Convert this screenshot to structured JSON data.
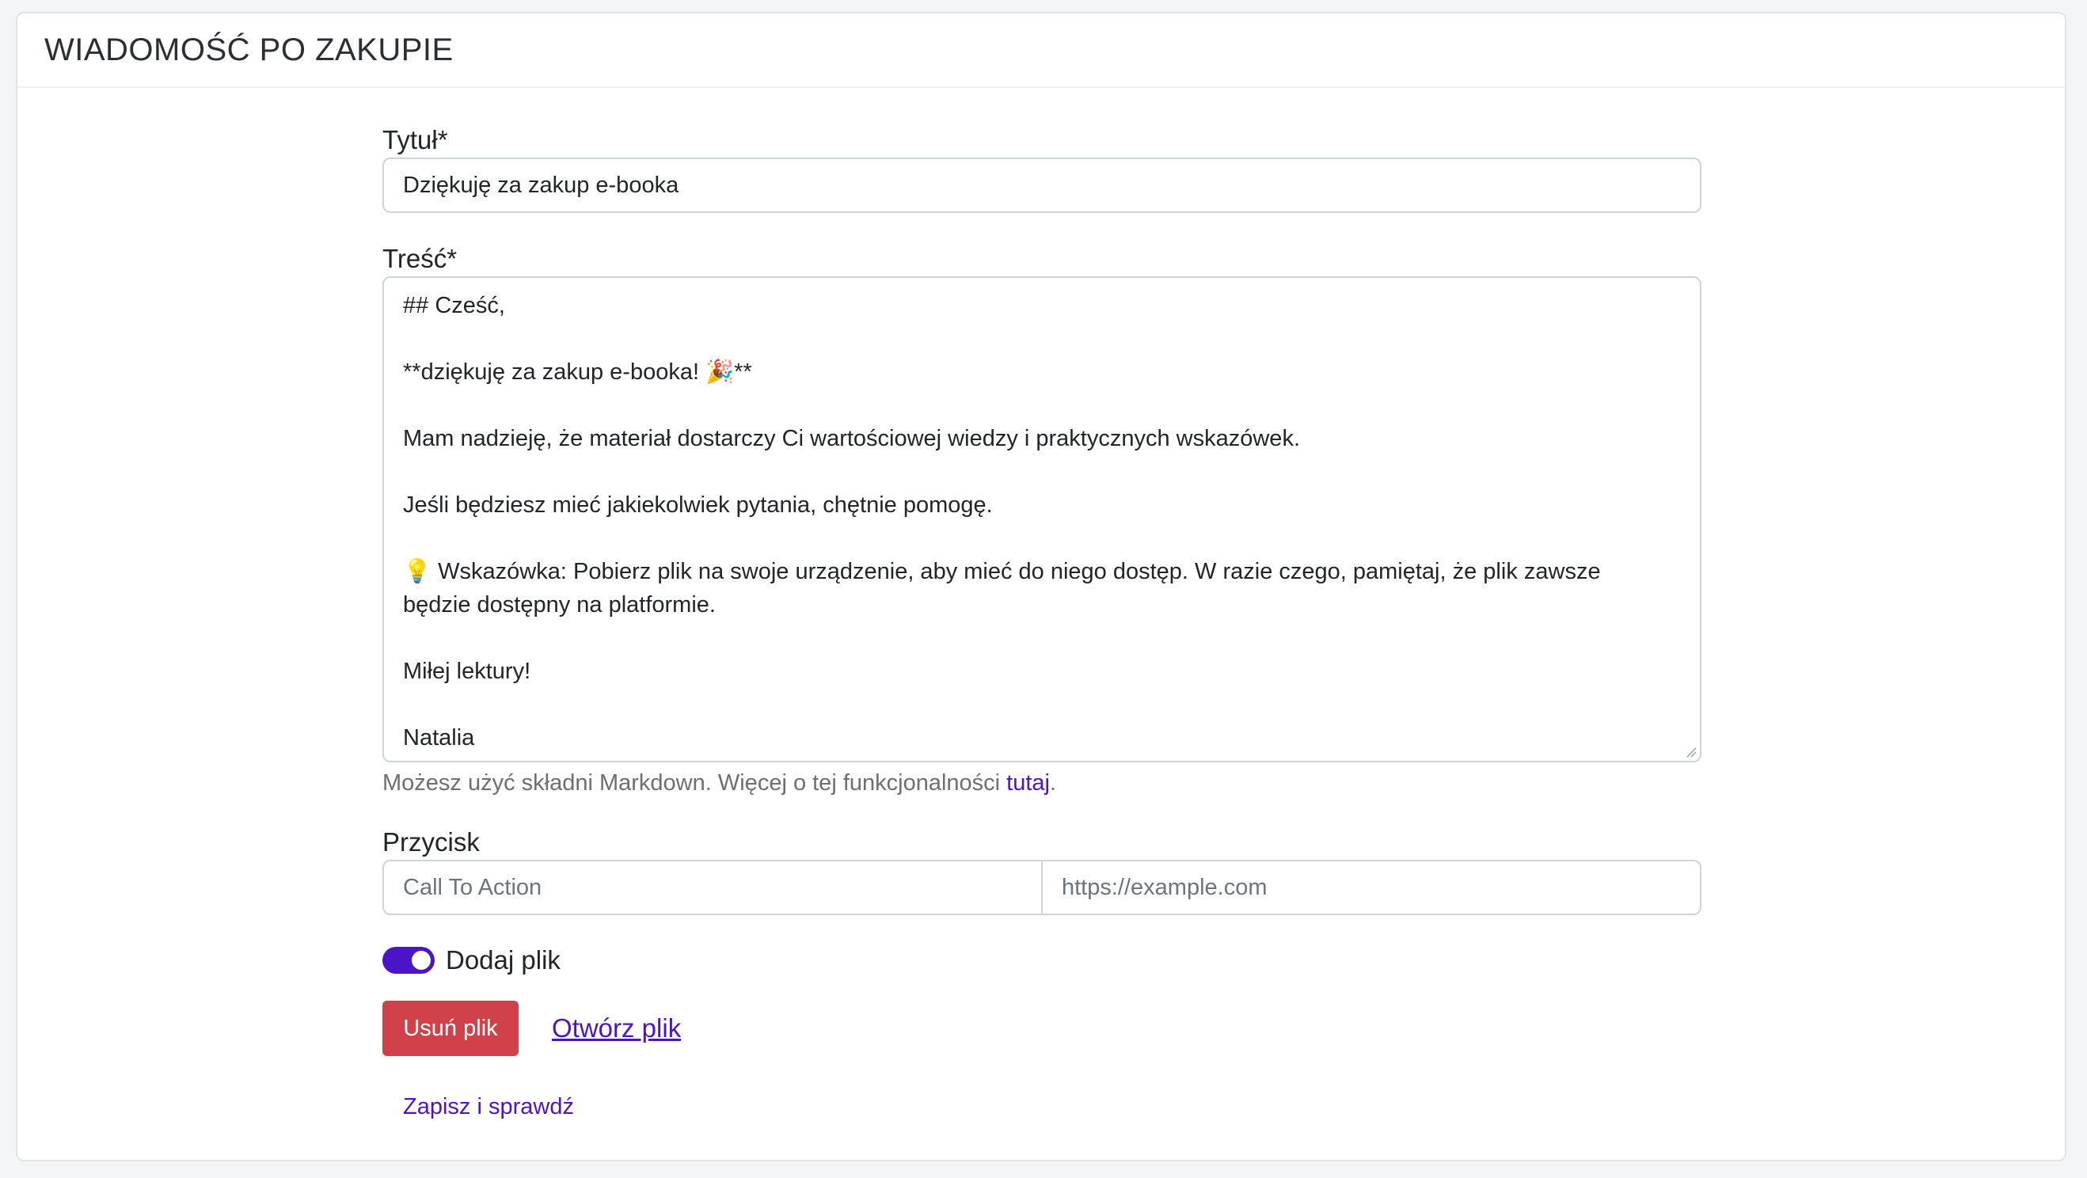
{
  "header": {
    "title": "WIADOMOŚĆ PO ZAKUPIE"
  },
  "form": {
    "title_label": "Tytuł*",
    "title_value": "Dziękuję za zakup e-booka",
    "content_label": "Treść*",
    "content_lines": [
      "## Cześć,",
      "",
      "**dziękuję za zakup e-booka! 🎉**",
      "",
      "Mam nadzieję, że materiał dostarczy Ci wartościowej wiedzy i praktycznych wskazówek.",
      "",
      "Jeśli będziesz mieć jakiekolwiek pytania, chętnie pomogę.",
      "",
      "💡 Wskazówka: Pobierz plik na swoje urządzenie, aby mieć do niego dostęp. W razie czego, pamiętaj, że plik zawsze",
      "będzie dostępny na platformie.",
      "",
      "Miłej lektury!",
      "",
      "Natalia"
    ],
    "markdown_help_prefix": "Możesz użyć składni Markdown. Więcej o tej funkcjonalności ",
    "markdown_help_link": "tutaj",
    "markdown_help_suffix": ".",
    "button_label": "Przycisk",
    "cta_placeholder": "Call To Action",
    "url_placeholder": "https://example.com",
    "add_file_label": "Dodaj plik",
    "add_file_enabled": true,
    "remove_file_button": "Usuń plik",
    "open_file_link": "Otwórz plik",
    "save_and_check_link": "Zapisz i sprawdź"
  },
  "colors": {
    "accent": "#4c14c8",
    "danger": "#d0414a"
  }
}
